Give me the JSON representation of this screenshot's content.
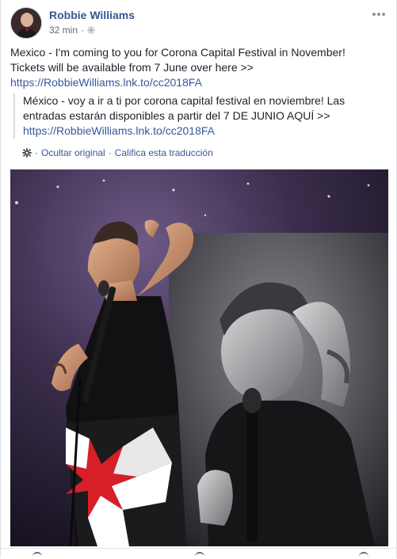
{
  "post": {
    "author": "Robbie Williams",
    "time": "32 min",
    "separator": "·",
    "text_line1": "Mexico - I'm coming to you for Corona Capital Festival in November!",
    "text_line2": "Tickets will be available from 7 June over here >>",
    "link": "https://RobbieWilliams.lnk.to/cc2018FA"
  },
  "translation": {
    "line1": "México - voy a ir a ti por corona capital festival en noviembre! Las",
    "line2": "entradas estarán disponibles a partir del 7 DE JUNIO AQUÍ >>",
    "link": "https://RobbieWilliams.lnk.to/cc2018FA",
    "hide_original": "Ocultar original",
    "rate": "Califica esta traducción",
    "dot": "·"
  },
  "colors": {
    "link": "#365899",
    "text": "#1d2129",
    "meta": "#616770"
  },
  "icons": {
    "privacy": "globe-icon",
    "options": "more-icon",
    "translate": "gear-icon"
  }
}
